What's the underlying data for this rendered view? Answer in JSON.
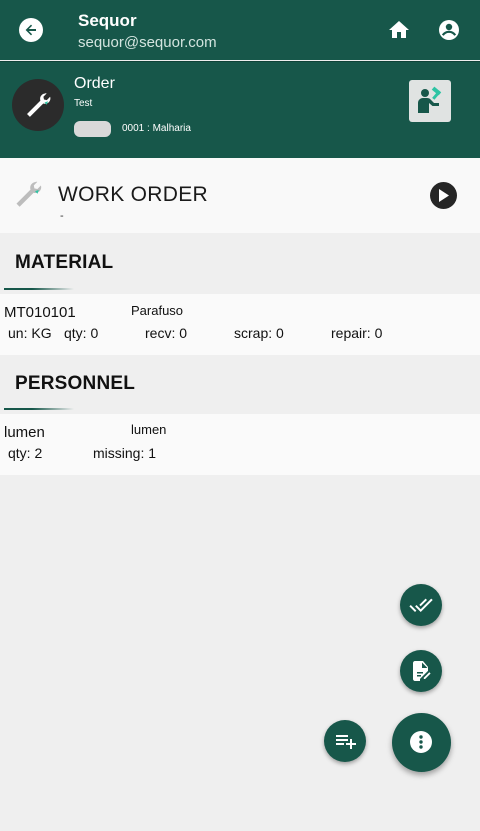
{
  "appbar": {
    "title": "Sequor",
    "subtitle": "sequor@sequor.com",
    "icons": [
      "back-arrow-icon",
      "home-icon",
      "account-icon"
    ]
  },
  "order": {
    "title": "Order",
    "subtitle": "Test",
    "code": "0001 : Malharia",
    "icons": [
      "wrench-icon",
      "operator-icon"
    ]
  },
  "work_order": {
    "title": "WORK ORDER",
    "subtitle": "-",
    "icons": [
      "wrench-icon",
      "play-icon"
    ]
  },
  "material": {
    "section_title": "MATERIAL",
    "items": [
      {
        "code": "MT010101",
        "description": "Parafuso",
        "unit": "un: KG",
        "qty": "qty: 0",
        "recv": "recv: 0",
        "scrap": "scrap: 0",
        "repair": "repair: 0"
      }
    ]
  },
  "personnel": {
    "section_title": "PERSONNEL",
    "items": [
      {
        "name": "lumen",
        "description": "lumen",
        "qty": "qty:  2",
        "missing": "missing:  1"
      }
    ]
  },
  "fabs": [
    "done-all-icon",
    "edit-document-icon",
    "playlist-add-icon",
    "more-vertical-icon"
  ],
  "colors": {
    "primary": "#17574a",
    "background": "#efefef",
    "card": "#fafafa",
    "accent": "#2ec4a4"
  }
}
